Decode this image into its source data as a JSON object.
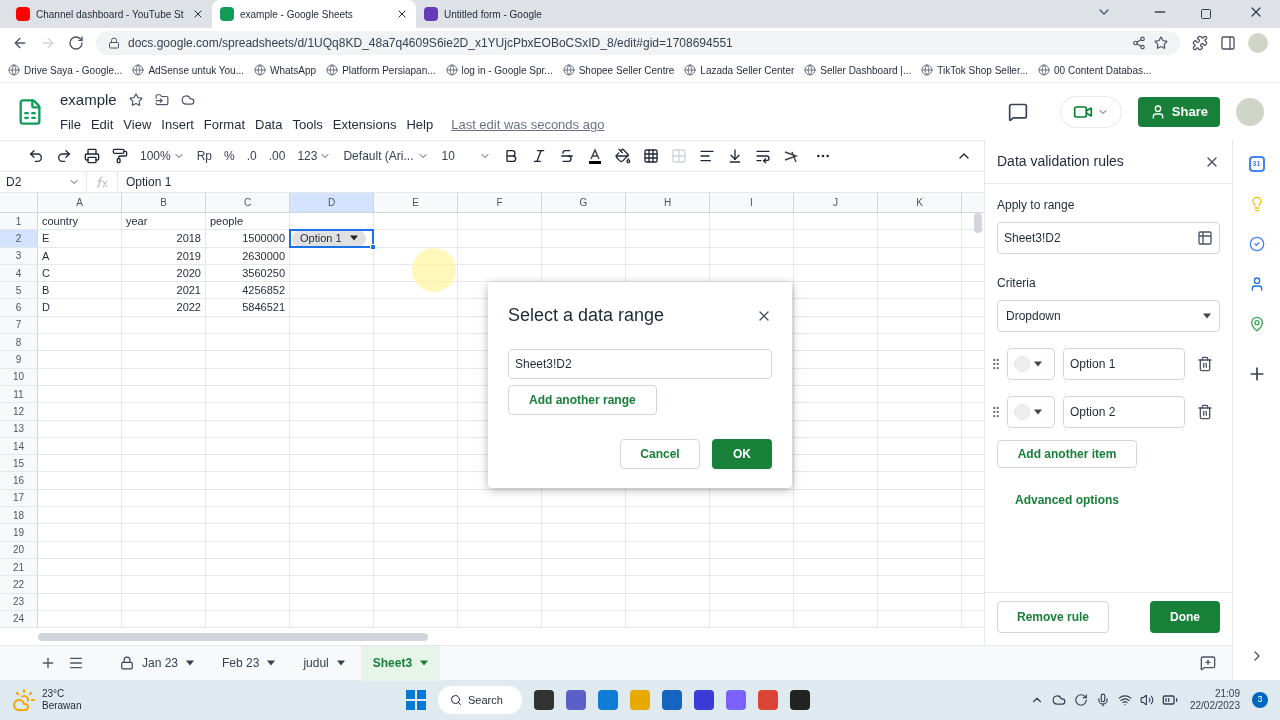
{
  "browser": {
    "tabs": [
      {
        "title": "Channel dashboard - YouTube St",
        "selected": false
      },
      {
        "title": "example - Google Sheets",
        "selected": true
      },
      {
        "title": "Untitled form - Google",
        "selected": false
      }
    ],
    "url": "docs.google.com/spreadsheets/d/1UQq8KD_48a7q4609S6ie2D_x1YUjcPbxEOBoCSxID_8/edit#gid=1708694551",
    "bookmarks": [
      "Drive Saya - Google...",
      "AdSense untuk You...",
      "WhatsApp",
      "Platform Persiapan...",
      "log in - Google Spr...",
      "Shopee Seller Centre",
      "Lazada Seller Center",
      "Seller Dashboard |...",
      "TikTok Shop Seller...",
      "00 Content Databas..."
    ]
  },
  "doc": {
    "title": "example",
    "menus": [
      "File",
      "Edit",
      "View",
      "Insert",
      "Format",
      "Data",
      "Tools",
      "Extensions",
      "Help"
    ],
    "last_edit": "Last edit was seconds ago",
    "share": "Share"
  },
  "toolbar": {
    "zoom": "100%",
    "currency": "Rp",
    "percent": "%",
    "decimal_less": ".0",
    "decimal_more": ".00",
    "number_format": "123",
    "font": "Default (Ari...",
    "font_size": "10"
  },
  "formula_bar": {
    "cell_ref": "D2",
    "value": "Option 1"
  },
  "grid": {
    "columns": [
      {
        "label": "A",
        "selected": false
      },
      {
        "label": "B",
        "selected": false
      },
      {
        "label": "C",
        "selected": false
      },
      {
        "label": "D",
        "selected": true
      },
      {
        "label": "E",
        "selected": false
      },
      {
        "label": "F",
        "selected": false
      },
      {
        "label": "G",
        "selected": false
      },
      {
        "label": "H",
        "selected": false
      },
      {
        "label": "I",
        "selected": false
      },
      {
        "label": "J",
        "selected": false
      },
      {
        "label": "K",
        "selected": false
      }
    ],
    "rows": [
      {
        "number": "1",
        "cells": [
          {
            "text": "country",
            "kind": "text",
            "selected": false
          },
          {
            "text": "year",
            "kind": "text",
            "selected": false
          },
          {
            "text": "people",
            "kind": "text",
            "selected": false
          }
        ]
      },
      {
        "number": "2",
        "cells": [
          {
            "text": "E",
            "kind": "text",
            "selected": false
          },
          {
            "text": "2018",
            "kind": "number",
            "selected": false
          },
          {
            "text": "1500000",
            "kind": "number",
            "selected": false
          },
          {
            "text": "Option 1",
            "kind": "chip",
            "selected": true
          }
        ]
      },
      {
        "number": "3",
        "cells": [
          {
            "text": "A",
            "kind": "text",
            "selected": false
          },
          {
            "text": "2019",
            "kind": "number",
            "selected": false
          },
          {
            "text": "2630000",
            "kind": "number",
            "selected": false
          }
        ]
      },
      {
        "number": "4",
        "cells": [
          {
            "text": "C",
            "kind": "text",
            "selected": false
          },
          {
            "text": "2020",
            "kind": "number",
            "selected": false
          },
          {
            "text": "3560250",
            "kind": "number",
            "selected": false
          }
        ]
      },
      {
        "number": "5",
        "cells": [
          {
            "text": "B",
            "kind": "text",
            "selected": false
          },
          {
            "text": "2021",
            "kind": "number",
            "selected": false
          },
          {
            "text": "4256852",
            "kind": "number",
            "selected": false
          }
        ]
      },
      {
        "number": "6",
        "cells": [
          {
            "text": "D",
            "kind": "text",
            "selected": false
          },
          {
            "text": "2022",
            "kind": "number",
            "selected": false
          },
          {
            "text": "5846521",
            "kind": "number",
            "selected": false
          }
        ]
      },
      {
        "number": "7"
      },
      {
        "number": "8"
      },
      {
        "number": "9"
      },
      {
        "number": "10"
      },
      {
        "number": "11"
      },
      {
        "number": "12"
      },
      {
        "number": "13"
      },
      {
        "number": "14"
      },
      {
        "number": "15"
      },
      {
        "number": "16"
      },
      {
        "number": "17"
      },
      {
        "number": "18"
      },
      {
        "number": "19"
      },
      {
        "number": "20"
      },
      {
        "number": "21"
      },
      {
        "number": "22"
      },
      {
        "number": "23"
      },
      {
        "number": "24"
      }
    ]
  },
  "sheet_tabs": [
    {
      "label": "Jan 23",
      "locked": true,
      "selected": false
    },
    {
      "label": "Feb 23",
      "locked": false,
      "selected": false
    },
    {
      "label": "judul",
      "locked": false,
      "selected": false
    },
    {
      "label": "Sheet3",
      "locked": false,
      "selected": true
    }
  ],
  "dialog": {
    "title": "Select a data range",
    "range": "Sheet3!D2",
    "add_range": "Add another range",
    "cancel": "Cancel",
    "ok": "OK"
  },
  "panel": {
    "title": "Data validation rules",
    "apply_label": "Apply to range",
    "apply_value": "Sheet3!D2",
    "criteria_label": "Criteria",
    "criteria_value": "Dropdown",
    "options": [
      {
        "value": "Option 1"
      },
      {
        "value": "Option 2"
      }
    ],
    "add_item": "Add another item",
    "advanced": "Advanced options",
    "remove": "Remove rule",
    "done": "Done"
  },
  "side_strip": {
    "calendar_day": "31"
  },
  "taskbar": {
    "temperature": "23°C",
    "weather": "Berawan",
    "search": "Search",
    "time": "21:09",
    "date": "22/02/2023",
    "notifications": "3"
  }
}
